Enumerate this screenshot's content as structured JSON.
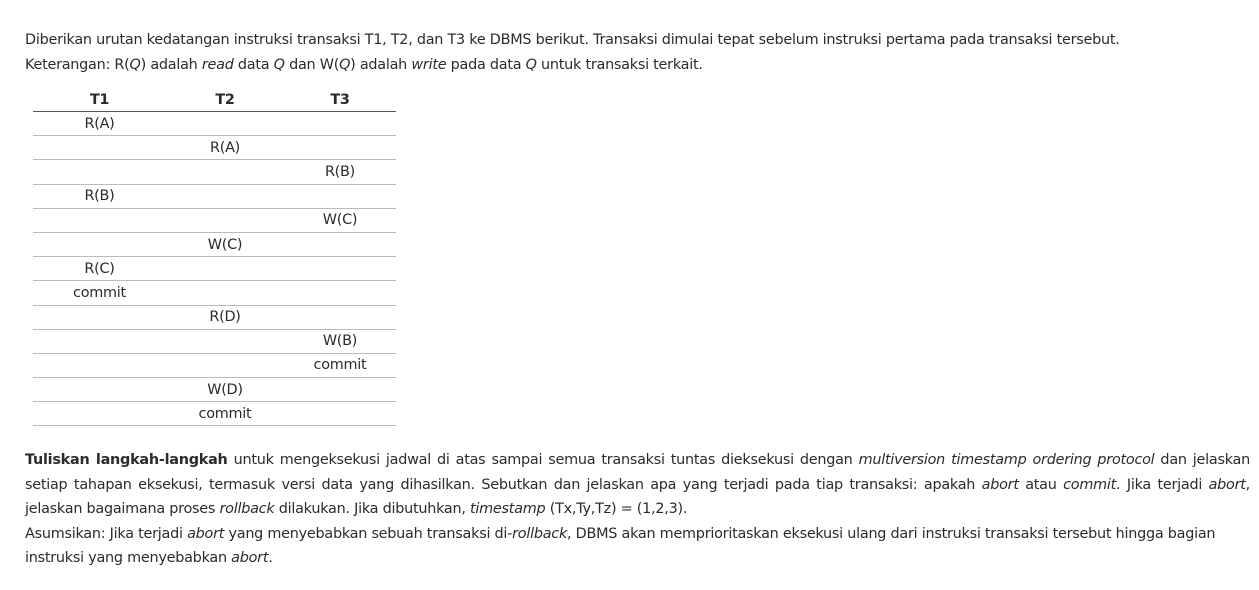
{
  "intro": {
    "line1": "Diberikan urutan kedatangan instruksi transaksi T1, T2, dan T3 ke DBMS berikut. Transaksi dimulai tepat sebelum instruksi pertama pada transaksi tersebut.",
    "line2_parts": [
      {
        "t": "Keterangan: R(",
        "i": false
      },
      {
        "t": "Q",
        "i": true
      },
      {
        "t": ") adalah ",
        "i": false
      },
      {
        "t": "read",
        "i": true
      },
      {
        "t": " data ",
        "i": false
      },
      {
        "t": "Q",
        "i": true
      },
      {
        "t": " dan W(",
        "i": false
      },
      {
        "t": "Q",
        "i": true
      },
      {
        "t": ") adalah ",
        "i": false
      },
      {
        "t": "write",
        "i": true
      },
      {
        "t": " pada data ",
        "i": false
      },
      {
        "t": "Q",
        "i": true
      },
      {
        "t": " untuk transaksi terkait.",
        "i": false
      }
    ]
  },
  "schedule": {
    "headers": [
      "T1",
      "T2",
      "T3"
    ],
    "rows": [
      [
        "R(A)",
        "",
        ""
      ],
      [
        "",
        "R(A)",
        ""
      ],
      [
        "",
        "",
        "R(B)"
      ],
      [
        "R(B)",
        "",
        ""
      ],
      [
        "",
        "",
        "W(C)"
      ],
      [
        "",
        "W(C)",
        ""
      ],
      [
        "R(C)",
        "",
        ""
      ],
      [
        "commit",
        "",
        ""
      ],
      [
        "",
        "R(D)",
        ""
      ],
      [
        "",
        "",
        "W(B)"
      ],
      [
        "",
        "",
        "commit"
      ],
      [
        "",
        "W(D)",
        ""
      ],
      [
        "",
        "commit",
        ""
      ]
    ]
  },
  "task": {
    "para1_parts": [
      {
        "t": "Tuliskan langkah-langkah",
        "b": true
      },
      {
        "t": " untuk mengeksekusi jadwal di atas sampai semua transaksi tuntas dieksekusi dengan "
      },
      {
        "t": "multiversion timestamp ordering protocol",
        "i": true
      },
      {
        "t": " dan jelaskan setiap tahapan eksekusi, termasuk versi data yang dihasilkan. Sebutkan dan jelaskan apa yang terjadi pada tiap transaksi: apakah "
      },
      {
        "t": "abort",
        "i": true
      },
      {
        "t": " atau "
      },
      {
        "t": "commit",
        "i": true
      },
      {
        "t": ". Jika terjadi "
      },
      {
        "t": "abort",
        "i": true
      },
      {
        "t": ", jelaskan bagaimana proses "
      },
      {
        "t": "rollback",
        "i": true
      },
      {
        "t": " dilakukan. Jika dibutuhkan, "
      },
      {
        "t": "timestamp",
        "i": true
      },
      {
        "t": " (Tx,Ty,Tz) = (1,2,3)."
      }
    ],
    "para2_parts": [
      {
        "t": "Asumsikan: Jika terjadi "
      },
      {
        "t": "abort",
        "i": true
      },
      {
        "t": " yang menyebabkan sebuah transaksi di-"
      },
      {
        "t": "rollback",
        "i": true
      },
      {
        "t": ", DBMS akan memprioritaskan eksekusi ulang dari instruksi transaksi tersebut hingga bagian instruksi yang menyebabkan "
      },
      {
        "t": "abort",
        "i": true
      },
      {
        "t": "."
      }
    ]
  }
}
